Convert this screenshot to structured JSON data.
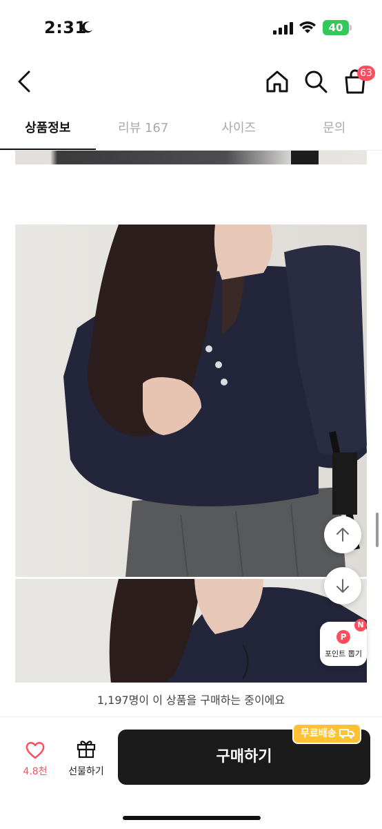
{
  "status_bar": {
    "time": "2:31",
    "battery": "40"
  },
  "header": {
    "cart_count": "63"
  },
  "tabs": [
    {
      "label": "상품정보",
      "active": true
    },
    {
      "label": "리뷰 167",
      "active": false
    },
    {
      "label": "사이즈",
      "active": false
    },
    {
      "label": "문의",
      "active": false
    }
  ],
  "floating": {
    "point_label": "포인트 뽑기",
    "point_icon": "P",
    "new_badge": "N"
  },
  "bottom": {
    "buying_notice": "1,197명이 이 상품을 구매하는 중이에요",
    "like_count": "4.8천",
    "gift_label": "선물하기",
    "buy_label": "구매하기",
    "free_shipping": "무료배송"
  },
  "colors": {
    "accent": "#ff4d5e",
    "buy_button": "#1b1b1b",
    "shipping_badge": "#ffc233"
  }
}
